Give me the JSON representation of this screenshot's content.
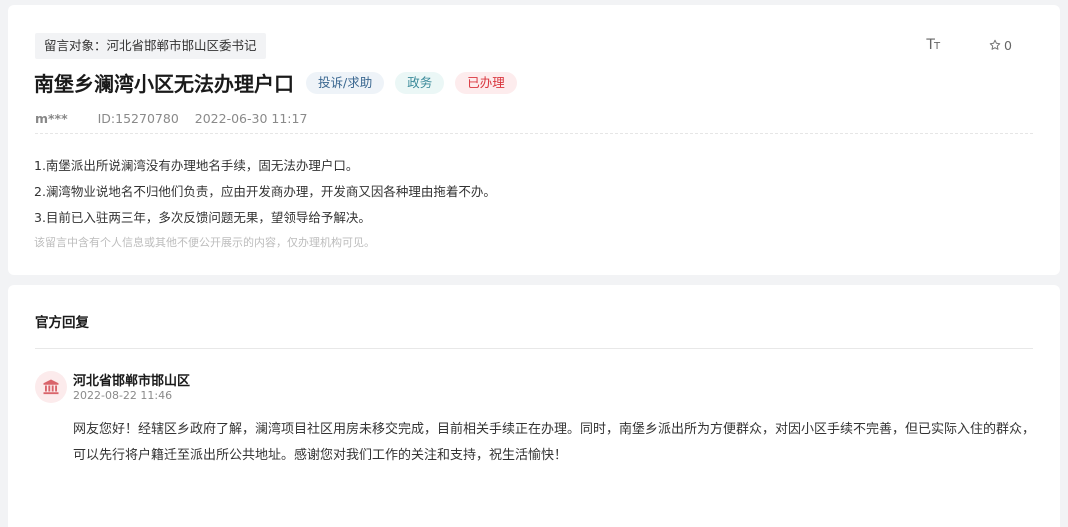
{
  "message": {
    "target_label": "留言对象：河北省邯郸市邯山区委书记",
    "tools": {
      "font_size_glyph": "T",
      "font_size_glyph_small": "T",
      "favorite_count": "0",
      "favorite_icon": "star-outline-icon"
    },
    "title": "南堡乡澜湾小区无法办理户口",
    "tags": {
      "category": "投诉/求助",
      "domain": "政务",
      "status": "已办理"
    },
    "meta": {
      "user": "m***",
      "id": "ID:15270780",
      "datetime": "2022-06-30 11:17"
    },
    "content": [
      "1.南堡派出所说澜湾没有办理地名手续，固无法办理户口。",
      "2.澜湾物业说地名不归他们负责，应由开发商办理，开发商又因各种理由拖着不办。",
      "3.目前已入驻两三年，多次反馈问题无果，望领导给予解决。"
    ],
    "privacy_note": "该留言中含有个人信息或其他不便公开展示的内容，仅办理机构可见。"
  },
  "reply": {
    "section_title": "官方回复",
    "org_icon": "government-building-icon",
    "org_name": "河北省邯郸市邯山区",
    "datetime": "2022-08-22 11:46",
    "body": "网友您好！经辖区乡政府了解，澜湾项目社区用房未移交完成，目前相关手续正在办理。同时，南堡乡派出所为方便群众，对因小区手续不完善，但已实际入住的群众，可以先行将户籍迁至派出所公共地址。感谢您对我们工作的关注和支持，祝生活愉快！"
  },
  "colors": {
    "page_bg": "#f2f3f5",
    "status_red": "#d9363e",
    "category_blue": "#3a6790",
    "domain_teal": "#3b8a9a"
  }
}
